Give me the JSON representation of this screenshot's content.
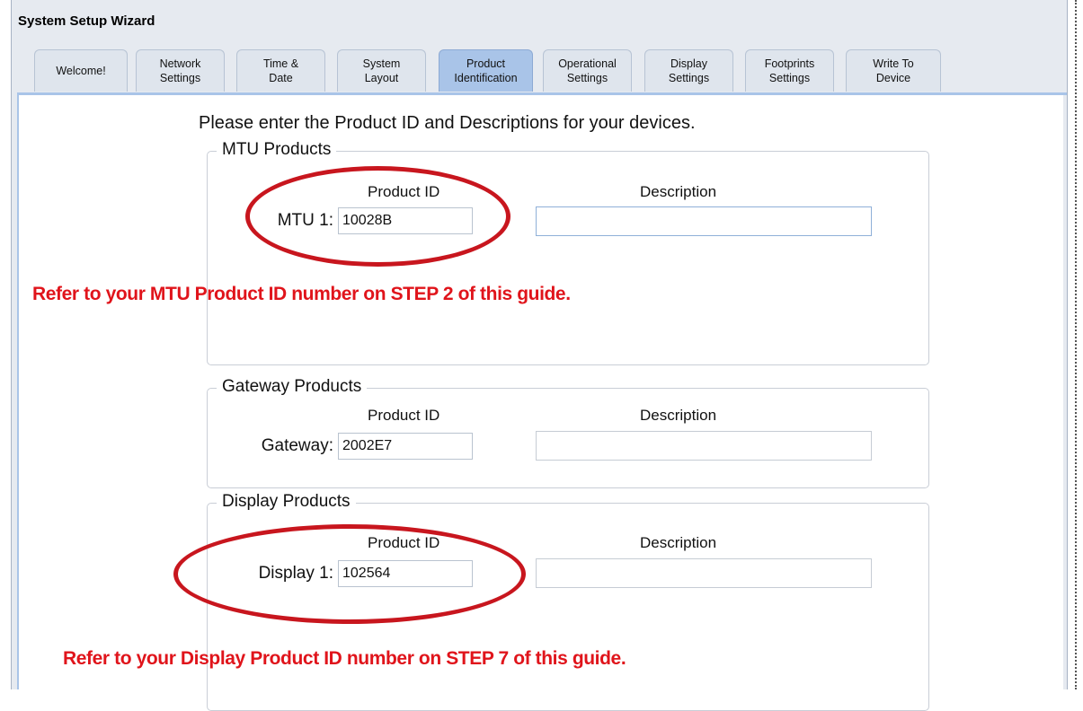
{
  "window": {
    "title": "System Setup Wizard"
  },
  "tabs": [
    {
      "label": "Welcome!"
    },
    {
      "label": "Network\nSettings"
    },
    {
      "label": "Time &\nDate"
    },
    {
      "label": "System\nLayout"
    },
    {
      "label": "Product\nIdentification",
      "active": true
    },
    {
      "label": "Operational\nSettings"
    },
    {
      "label": "Display\nSettings"
    },
    {
      "label": "Footprints\nSettings"
    },
    {
      "label": "Write To\nDevice"
    }
  ],
  "instruction": "Please enter the Product ID and Descriptions for your devices.",
  "mtu": {
    "legend": "MTU Products",
    "product_id_header": "Product ID",
    "description_header": "Description",
    "row_label": "MTU 1:",
    "product_id": "10028B",
    "description": ""
  },
  "gateway": {
    "legend": "Gateway Products",
    "product_id_header": "Product ID",
    "description_header": "Description",
    "row_label": "Gateway:",
    "product_id": "2002E7",
    "description": ""
  },
  "display": {
    "legend": "Display Products",
    "product_id_header": "Product ID",
    "description_header": "Description",
    "row_label": "Display 1:",
    "product_id": "102564",
    "description": ""
  },
  "annotations": {
    "mtu_note": "Refer to your MTU Product ID number on STEP 2 of this guide.",
    "display_note": "Refer to your Display Product ID number on STEP 7 of this guide.",
    "color": "#e0141b",
    "ellipse_color": "#c8161e"
  },
  "colors": {
    "active_tab": "#a9c4e8",
    "tab": "#dfe5ed",
    "window_bg": "#e6eaf0"
  }
}
